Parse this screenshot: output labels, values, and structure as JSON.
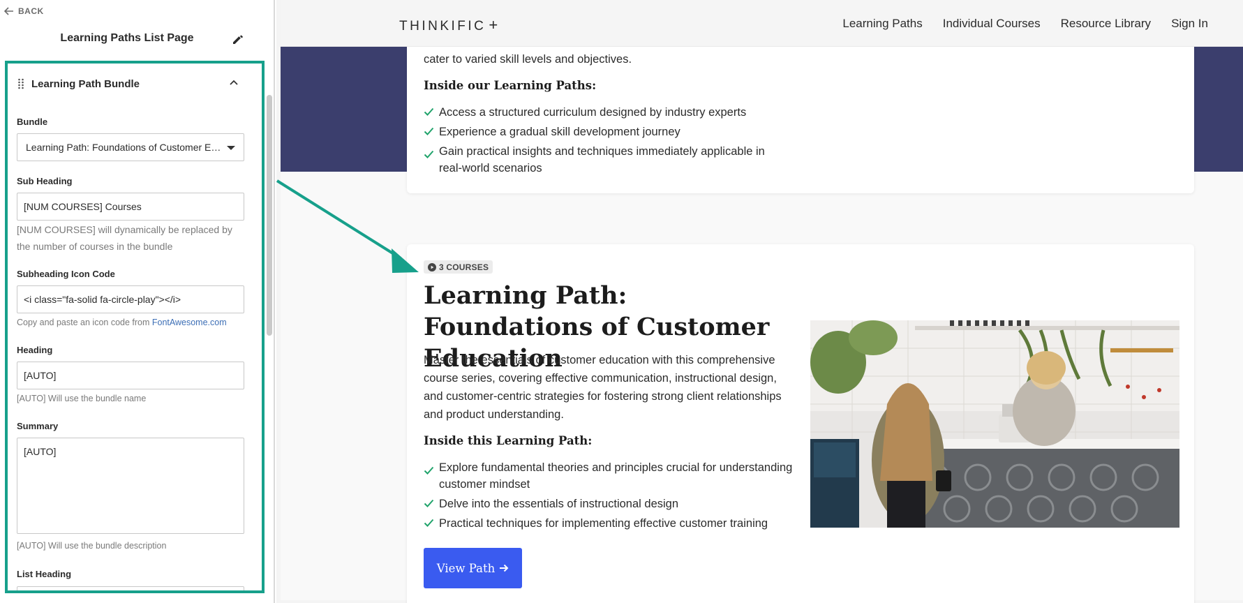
{
  "editor": {
    "back_label": "BACK",
    "title": "Learning Paths List Page",
    "section_title": "Learning Path Bundle",
    "bundle": {
      "label": "Bundle",
      "selected": "Learning Path: Foundations of Customer Education"
    },
    "sub_heading": {
      "label": "Sub Heading",
      "value": "[NUM COURSES] Courses",
      "help": "[NUM COURSES] will dynamically be replaced by the number of courses in the bundle"
    },
    "icon_code": {
      "label": "Subheading Icon Code",
      "value": "<i class=\"fa-solid fa-circle-play\"></i>",
      "help_prefix": "Copy and paste an icon code from ",
      "help_link": "FontAwesome.com"
    },
    "heading": {
      "label": "Heading",
      "value": "[AUTO]",
      "help": "[AUTO] Will use the bundle name"
    },
    "summary": {
      "label": "Summary",
      "value": "[AUTO]",
      "help": "[AUTO] Will use the bundle description"
    },
    "list_heading": {
      "label": "List Heading"
    }
  },
  "site": {
    "logo": "THINKIFIC",
    "logo_plus": "+",
    "nav": [
      "Learning Paths",
      "Individual Courses",
      "Resource Library",
      "Sign In"
    ],
    "card1": {
      "intro_tail": "cater to varied skill levels and objectives.",
      "list_heading": "Inside our Learning Paths:",
      "items": [
        "Access a structured curriculum designed by industry experts",
        "Experience a gradual skill development journey",
        "Gain practical insights and techniques immediately applicable in real-world scenarios"
      ]
    },
    "card2": {
      "badge": "3 COURSES",
      "title": "Learning Path: Foundations of Customer Education",
      "description": "Master the essentials of customer education with this comprehensive course series, covering effective communication, instructional design, and customer-centric strategies for fostering strong client relationships and product understanding.",
      "list_heading": "Inside this Learning Path:",
      "items": [
        "Explore fundamental theories and principles crucial for understanding customer mindset",
        "Delve into the essentials of instructional design",
        "Practical techniques for implementing effective customer training"
      ],
      "button": "View Path"
    }
  },
  "colors": {
    "highlight": "#17a08b",
    "hero": "#3b3e6d",
    "button": "#3a5bf0",
    "check": "#20a36b",
    "link": "#3d6fb6"
  }
}
